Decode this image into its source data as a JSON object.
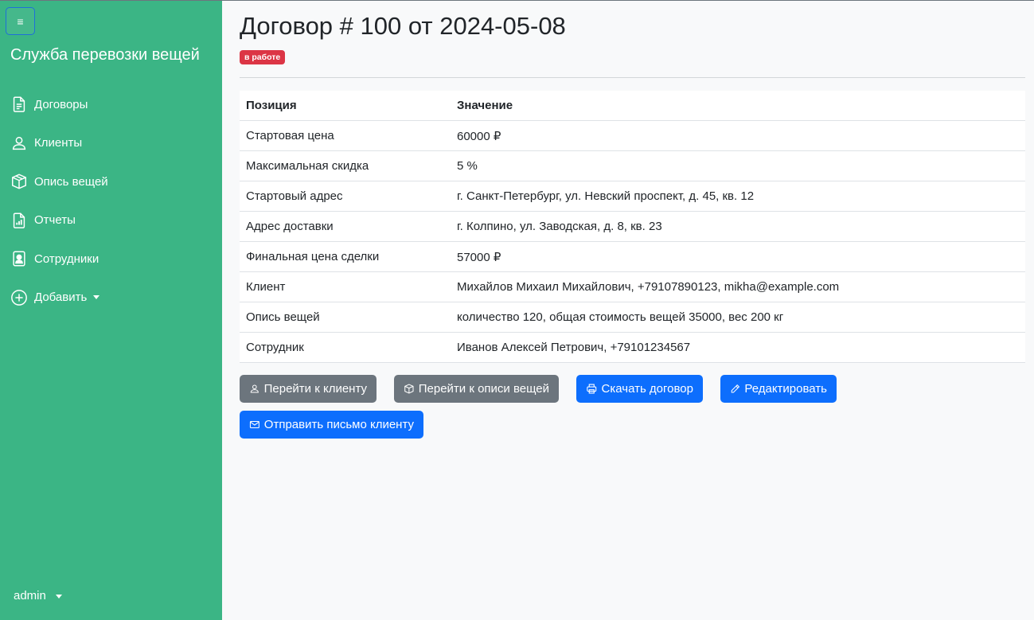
{
  "sidebar": {
    "toggle_glyph": "≡",
    "brand": "Служба перевозки вещей",
    "items": [
      {
        "label": "Договоры",
        "icon": "document-icon"
      },
      {
        "label": "Клиенты",
        "icon": "person-icon"
      },
      {
        "label": "Опись вещей",
        "icon": "box-icon"
      },
      {
        "label": "Отчеты",
        "icon": "report-icon"
      },
      {
        "label": "Сотрудники",
        "icon": "badge-icon"
      },
      {
        "label": "Добавить",
        "icon": "plus-circle-icon"
      }
    ],
    "user": "admin"
  },
  "contract": {
    "title": "Договор # 100 от 2024-05-08",
    "status": "в работе"
  },
  "table": {
    "headers": [
      "Позиция",
      "Значение"
    ],
    "rows": [
      [
        "Стартовая цена",
        "60000 ₽"
      ],
      [
        "Максимальная скидка",
        "5 %"
      ],
      [
        "Стартовый адрес",
        "г. Санкт-Петербург, ул. Невский проспект, д. 45, кв. 12"
      ],
      [
        "Адрес доставки",
        "г. Колпино, ул. Заводская, д. 8, кв. 23"
      ],
      [
        "Финальная цена сделки",
        "57000 ₽"
      ],
      [
        "Клиент",
        "Михайлов Михаил Михайлович, +79107890123, mikha@example.com"
      ],
      [
        "Опись вещей",
        "количество 120, общая стоимость вещей 35000, вес 200 кг"
      ],
      [
        "Сотрудник",
        "Иванов Алексей Петрович, +79101234567"
      ]
    ]
  },
  "actions": {
    "go_client": "Перейти к клиенту",
    "go_inventory": "Перейти к описи вещей",
    "download": "Скачать договор",
    "edit": "Редактировать",
    "send_email": "Отправить письмо клиенту"
  },
  "colors": {
    "sidebar_bg": "#3bb585",
    "status_badge": "#dc3545",
    "primary": "#0d6efd",
    "secondary": "#6c757d"
  }
}
